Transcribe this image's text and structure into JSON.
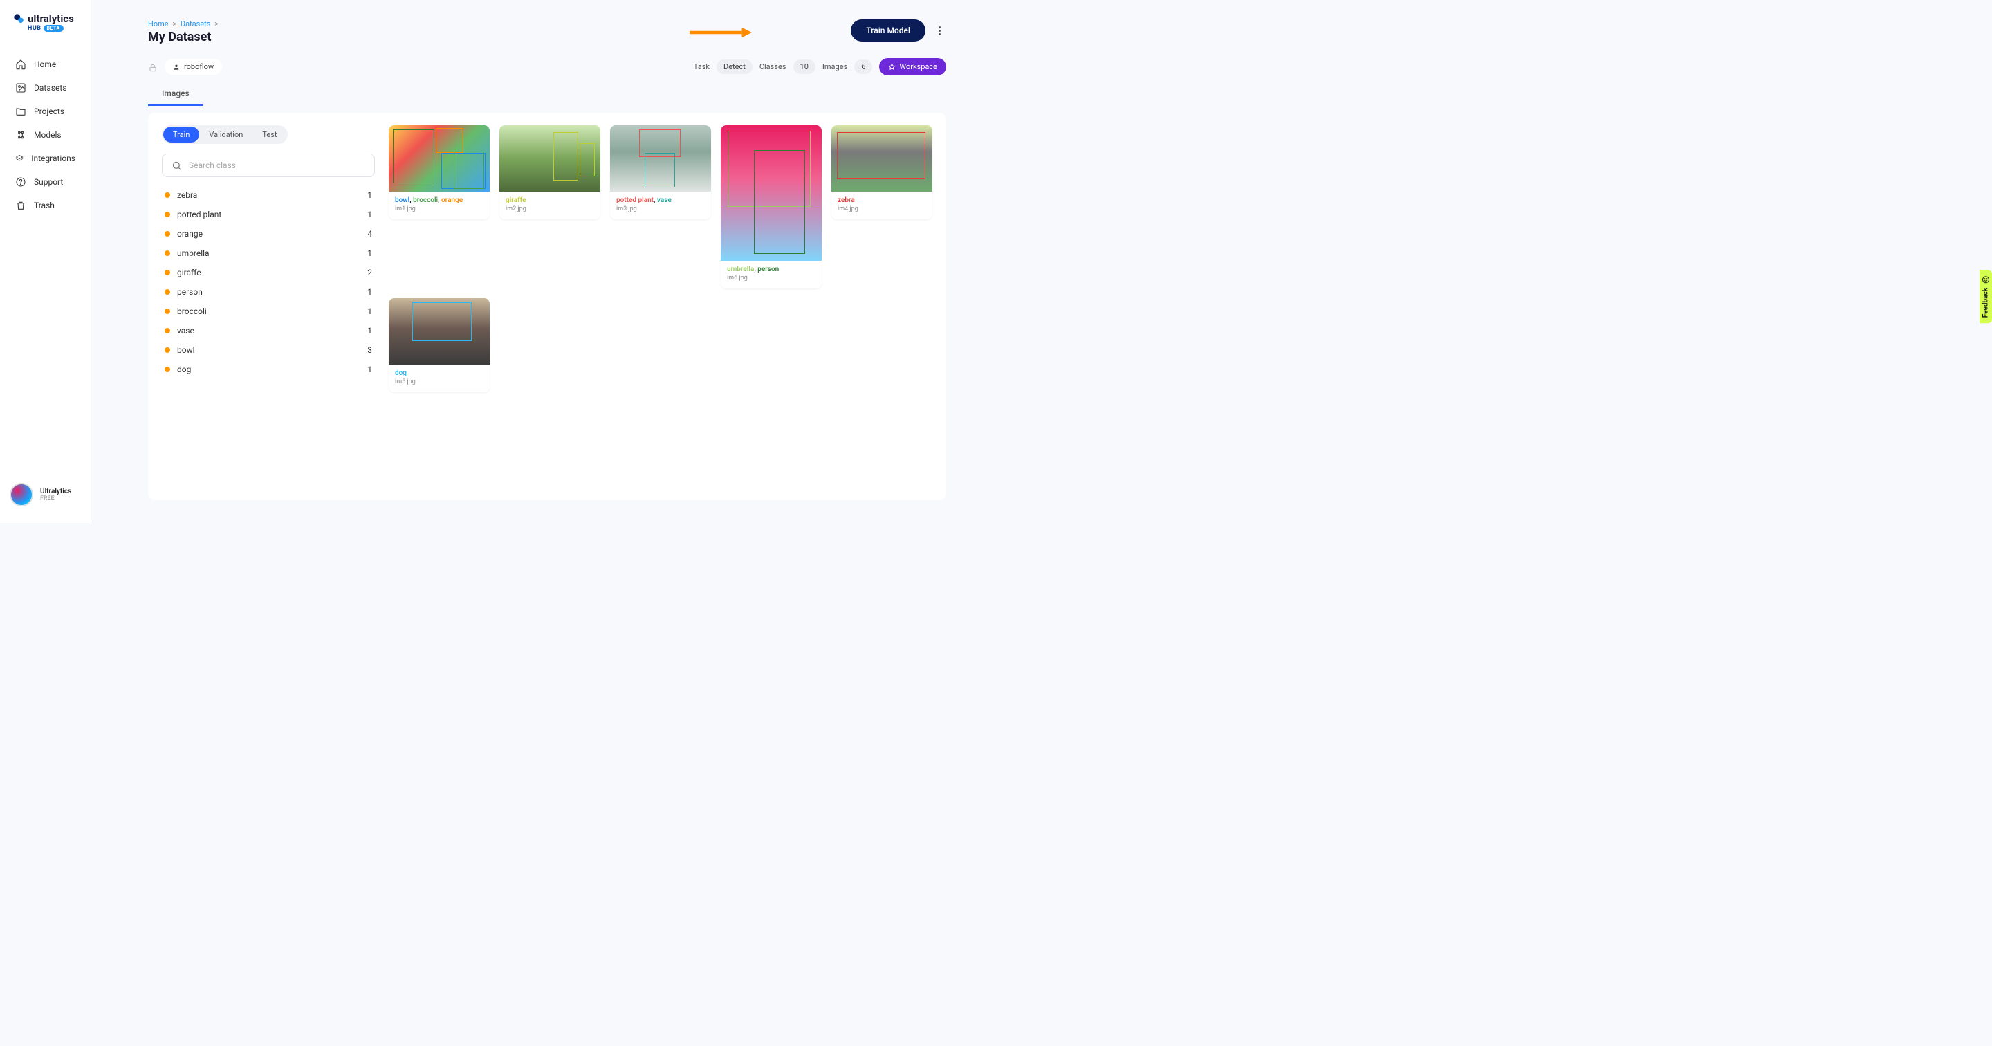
{
  "brand": {
    "name": "ultralytics",
    "sub": "HUB",
    "beta": "BETA"
  },
  "sidebar": {
    "items": [
      {
        "label": "Home"
      },
      {
        "label": "Datasets"
      },
      {
        "label": "Projects"
      },
      {
        "label": "Models"
      },
      {
        "label": "Integrations"
      },
      {
        "label": "Support"
      },
      {
        "label": "Trash"
      }
    ]
  },
  "user": {
    "name": "Ultralytics",
    "plan": "FREE"
  },
  "breadcrumb": {
    "home": "Home",
    "datasets": "Datasets",
    "sep": ">"
  },
  "page": {
    "title": "My Dataset",
    "owner": "roboflow"
  },
  "header": {
    "train_label": "Train Model"
  },
  "meta": {
    "task_label": "Task",
    "task_value": "Detect",
    "classes_label": "Classes",
    "classes_value": "10",
    "images_label": "Images",
    "images_value": "6",
    "workspace_label": "Workspace"
  },
  "tabs": {
    "images": "Images"
  },
  "splits": {
    "train": "Train",
    "validation": "Validation",
    "test": "Test"
  },
  "search": {
    "placeholder": "Search class"
  },
  "classes": [
    {
      "name": "zebra",
      "count": "1"
    },
    {
      "name": "potted plant",
      "count": "1"
    },
    {
      "name": "orange",
      "count": "4"
    },
    {
      "name": "umbrella",
      "count": "1"
    },
    {
      "name": "giraffe",
      "count": "2"
    },
    {
      "name": "person",
      "count": "1"
    },
    {
      "name": "broccoli",
      "count": "1"
    },
    {
      "name": "vase",
      "count": "1"
    },
    {
      "name": "bowl",
      "count": "3"
    },
    {
      "name": "dog",
      "count": "1"
    }
  ],
  "cards": {
    "c1": {
      "file": "im1.jpg",
      "labels": [
        {
          "t": "bowl",
          "c": "lbl-bowl"
        },
        {
          "t": ", "
        },
        {
          "t": "broccoli",
          "c": "lbl-broccoli"
        },
        {
          "t": ", "
        },
        {
          "t": "orange",
          "c": "lbl-orange"
        }
      ]
    },
    "c2": {
      "file": "im2.jpg",
      "labels": [
        {
          "t": "giraffe",
          "c": "lbl-giraffe"
        }
      ]
    },
    "c3": {
      "file": "im3.jpg",
      "labels": [
        {
          "t": "potted plant",
          "c": "lbl-potted"
        },
        {
          "t": ", "
        },
        {
          "t": "vase",
          "c": "lbl-vase"
        }
      ]
    },
    "c4": {
      "file": "im6.jpg",
      "labels": [
        {
          "t": "umbrella",
          "c": "lbl-umbrella"
        },
        {
          "t": ", "
        },
        {
          "t": "person",
          "c": "lbl-person"
        }
      ]
    },
    "c5": {
      "file": "im4.jpg",
      "labels": [
        {
          "t": "zebra",
          "c": "lbl-zebra"
        }
      ]
    },
    "c6": {
      "file": "im5.jpg",
      "labels": [
        {
          "t": "dog",
          "c": "lbl-dog"
        }
      ]
    }
  },
  "feedback": {
    "label": "Feedback"
  }
}
